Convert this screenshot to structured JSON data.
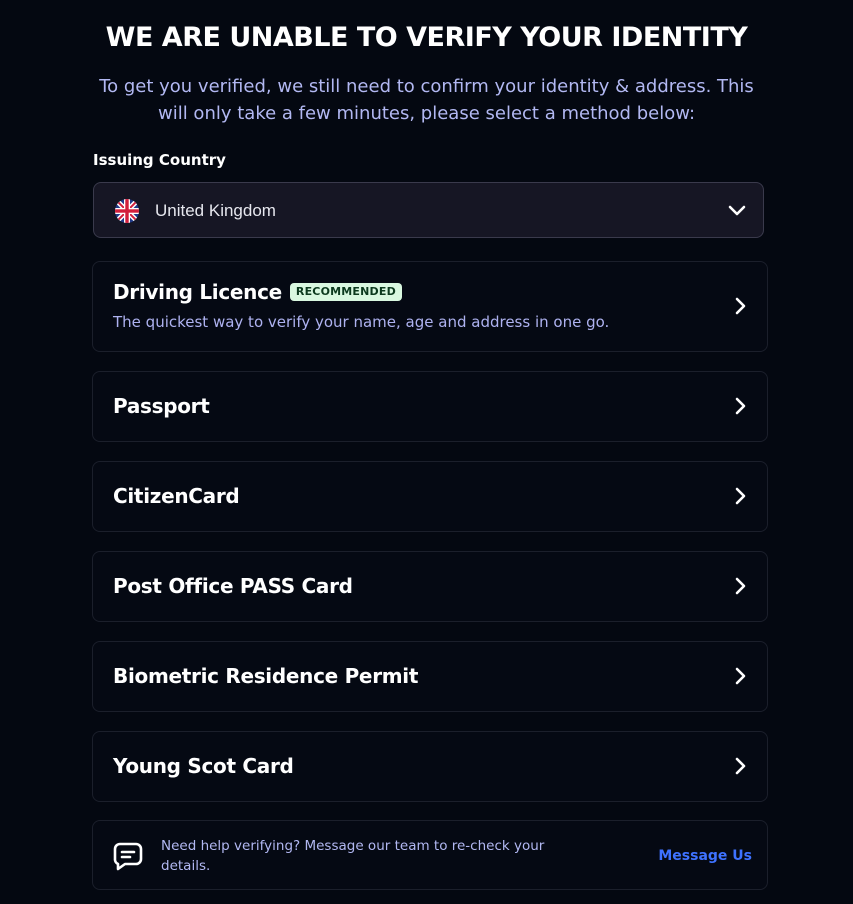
{
  "header": {
    "title": "WE ARE UNABLE TO VERIFY YOUR IDENTITY",
    "subtitle": "To get you verified, we still need to confirm your identity & address. This will only take a few minutes, please select a method below:"
  },
  "country": {
    "label": "Issuing Country",
    "value": "United Kingdom",
    "flag_icon": "uk-flag-icon",
    "toggle_icon": "chevron-down-icon"
  },
  "methods": [
    {
      "title": "Driving Licence",
      "badge": "RECOMMENDED",
      "description": "The quickest way to verify your name, age and address in one go."
    },
    {
      "title": "Passport"
    },
    {
      "title": "CitizenCard"
    },
    {
      "title": "Post Office PASS Card"
    },
    {
      "title": "Biometric Residence Permit"
    },
    {
      "title": "Young Scot Card"
    }
  ],
  "help": {
    "icon": "chat-bubble-icon",
    "text": "Need help verifying? Message our team to re-check your details.",
    "link_label": "Message Us"
  },
  "colors": {
    "background": "#040811",
    "subtitle": "#b2b8f2",
    "badge_bg": "#d9f8e0",
    "link": "#3e72ff"
  }
}
